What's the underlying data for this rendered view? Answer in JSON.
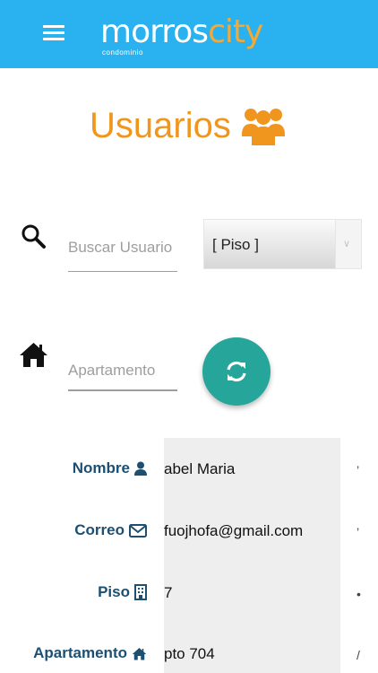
{
  "header": {
    "logo_part1": "morros",
    "logo_part2": "city",
    "logo_subtitle": "condominio",
    "colors": {
      "background": "#29b2ef",
      "logo_accent": "#f3a93a"
    }
  },
  "title": {
    "text": "Usuarios",
    "icon": "users-icon",
    "color": "#f0961f"
  },
  "filters": {
    "search_placeholder": "Buscar Usuario",
    "search_icon": "search-icon",
    "floor_select_value": "[ Piso ]",
    "floor_select_icon": "chevron-down-icon",
    "apartment_placeholder": "Apartamento",
    "apartment_icon": "home-icon",
    "refresh_icon": "refresh-icon",
    "refresh_color": "#26a69a"
  },
  "details": {
    "labels": {
      "name": "Nombre",
      "email": "Correo",
      "floor": "Piso",
      "apartment": "Apartamento"
    },
    "label_icons": [
      "user-icon",
      "envelope-icon",
      "building-icon",
      "home-icon"
    ],
    "values": {
      "name": "abel Maria",
      "email": "fuojhofa@gmail.com",
      "floor": "7",
      "apartment": "pto 704"
    },
    "label_color": "#1d4f73"
  }
}
